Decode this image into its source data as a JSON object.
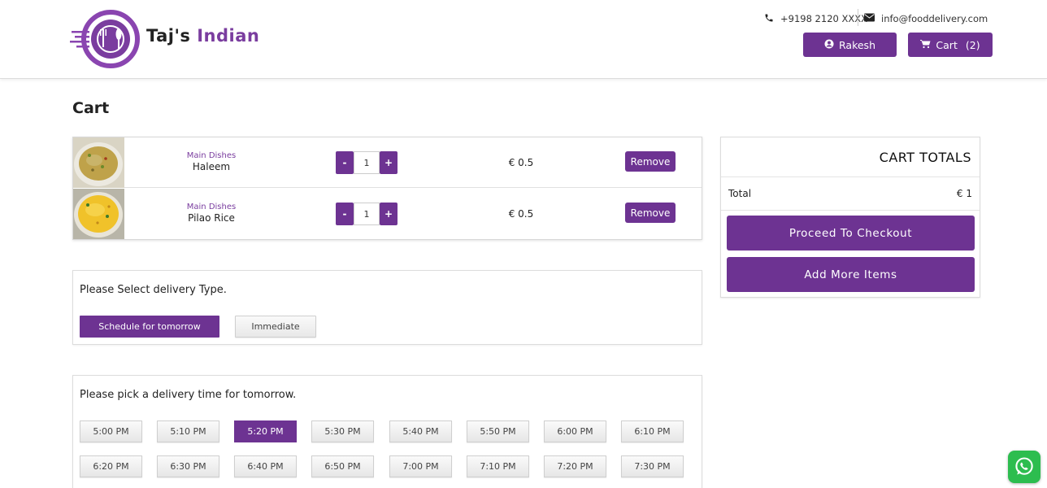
{
  "header": {
    "brand_word1": "Taj's",
    "brand_word2": "Indian",
    "phone": "+9198 2120 XXXX",
    "email": "info@fooddelivery.com",
    "user_label": "Rakesh",
    "cart_label": "Cart",
    "cart_count": "(2)"
  },
  "page": {
    "title": "Cart"
  },
  "cart_items": [
    {
      "category": "Main Dishes",
      "name": "Haleem",
      "qty": "1",
      "price": "€ 0.5",
      "remove_label": "Remove",
      "minus": "-",
      "plus": "+"
    },
    {
      "category": "Main Dishes",
      "name": "Pilao Rice",
      "qty": "1",
      "price": "€ 0.5",
      "remove_label": "Remove",
      "minus": "-",
      "plus": "+"
    }
  ],
  "delivery_type": {
    "prompt": "Please Select delivery Type.",
    "options": [
      "Schedule for tomorrow",
      "Immediate"
    ],
    "selected": "Schedule for tomorrow"
  },
  "delivery_time": {
    "prompt": "Please pick a delivery time for tomorrow.",
    "slots": [
      "5:00 PM",
      "5:10 PM",
      "5:20 PM",
      "5:30 PM",
      "5:40 PM",
      "5:50 PM",
      "6:00 PM",
      "6:10 PM",
      "6:20 PM",
      "6:30 PM",
      "6:40 PM",
      "6:50 PM",
      "7:00 PM",
      "7:10 PM",
      "7:20 PM",
      "7:30 PM"
    ],
    "selected": "5:20 PM"
  },
  "totals": {
    "title": "CART TOTALS",
    "total_label": "Total",
    "total_value": "€ 1",
    "checkout_label": "Proceed To Checkout",
    "add_more_label": "Add More Items"
  },
  "colors": {
    "accent": "#6d3392",
    "brand_text": "#7a3d9f",
    "whatsapp": "#2dbd4f"
  },
  "icons": [
    "logo-icon",
    "phone-icon",
    "envelope-icon",
    "user-icon",
    "cart-icon",
    "whatsapp-icon"
  ]
}
